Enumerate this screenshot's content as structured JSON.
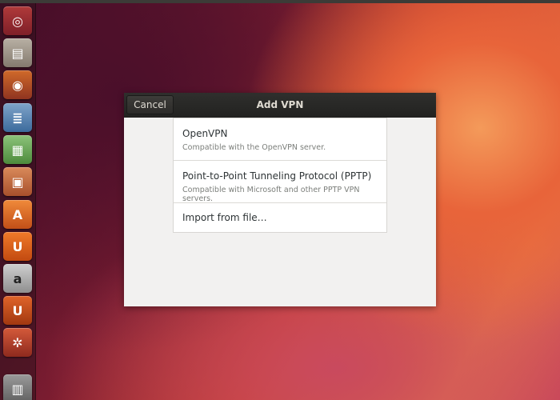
{
  "dialog": {
    "title": "Add VPN",
    "cancel_label": "Cancel",
    "options": [
      {
        "title": "OpenVPN",
        "subtitle": "Compatible with the OpenVPN server."
      },
      {
        "title": "Point-to-Point Tunneling Protocol (PPTP)",
        "subtitle": "Compatible with Microsoft and other PPTP VPN servers."
      },
      {
        "title": "Import from file…"
      }
    ]
  },
  "launcher": {
    "items": [
      {
        "icon": "ubuntu-dash-icon",
        "glyph": "◎"
      },
      {
        "icon": "files-icon",
        "glyph": "▤"
      },
      {
        "icon": "firefox-icon",
        "glyph": "◉"
      },
      {
        "icon": "libreoffice-writer-icon",
        "glyph": "≣"
      },
      {
        "icon": "libreoffice-calc-icon",
        "glyph": "▦"
      },
      {
        "icon": "libreoffice-impress-icon",
        "glyph": "▣"
      },
      {
        "icon": "software-center-icon",
        "glyph": "A"
      },
      {
        "icon": "ubuntu-one-icon",
        "glyph": "U"
      },
      {
        "icon": "amazon-icon",
        "glyph": "a"
      },
      {
        "icon": "ubuntu-one-music-icon",
        "glyph": "U"
      },
      {
        "icon": "system-settings-icon",
        "glyph": "✲"
      },
      {
        "icon": "trash-icon",
        "glyph": "▥"
      }
    ]
  },
  "colors": {
    "headerbar": "#2f2f2d",
    "dialog_bg": "#f2f1f0",
    "list_bg": "#ffffff",
    "title_text": "#dfdbd2",
    "subtitle_text": "#7b7e7a"
  }
}
